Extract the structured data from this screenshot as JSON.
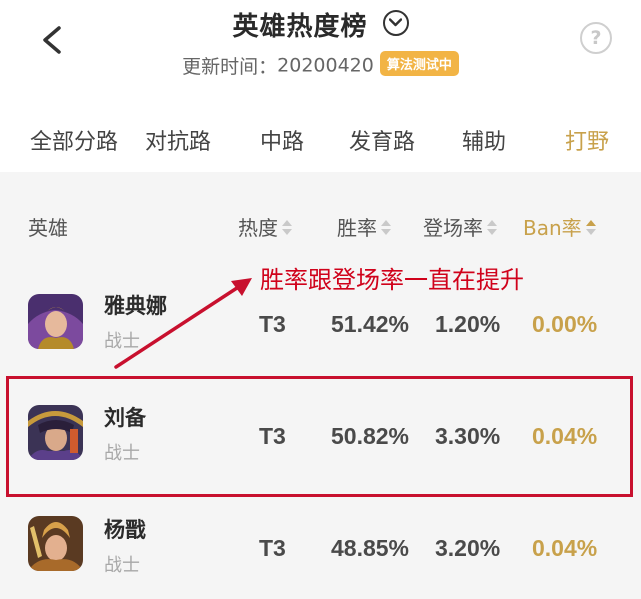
{
  "header": {
    "title": "英雄热度榜",
    "update_label": "更新时间：",
    "update_value": "20200420",
    "algo_badge": "算法测试中",
    "back_icon": "back-arrow-icon",
    "chevron_icon": "chevron-down-icon",
    "help_text": "?"
  },
  "tabs": [
    {
      "label": "全部分路",
      "active": false
    },
    {
      "label": "对抗路",
      "active": false
    },
    {
      "label": "中路",
      "active": false
    },
    {
      "label": "发育路",
      "active": false
    },
    {
      "label": "辅助",
      "active": false
    },
    {
      "label": "打野",
      "active": true
    }
  ],
  "columns": {
    "hero": "英雄",
    "heat": "热度",
    "win_rate": "胜率",
    "pick_rate": "登场率",
    "ban_rate": "Ban率",
    "active_sort": "ban_rate"
  },
  "rows": [
    {
      "name": "雅典娜",
      "role": "战士",
      "tier": "T3",
      "win_rate": "51.42%",
      "pick_rate": "1.20%",
      "ban_rate": "0.00%"
    },
    {
      "name": "刘备",
      "role": "战士",
      "tier": "T3",
      "win_rate": "50.82%",
      "pick_rate": "3.30%",
      "ban_rate": "0.04%"
    },
    {
      "name": "杨戬",
      "role": "战士",
      "tier": "T3",
      "win_rate": "48.85%",
      "pick_rate": "3.20%",
      "ban_rate": "0.04%"
    }
  ],
  "annotation": {
    "text": "胜率跟登场率一直在提升",
    "color": "#d0021b"
  },
  "colors": {
    "accent": "#c8a14b",
    "badge": "#f2b445",
    "annotation_red": "#c8102e"
  }
}
